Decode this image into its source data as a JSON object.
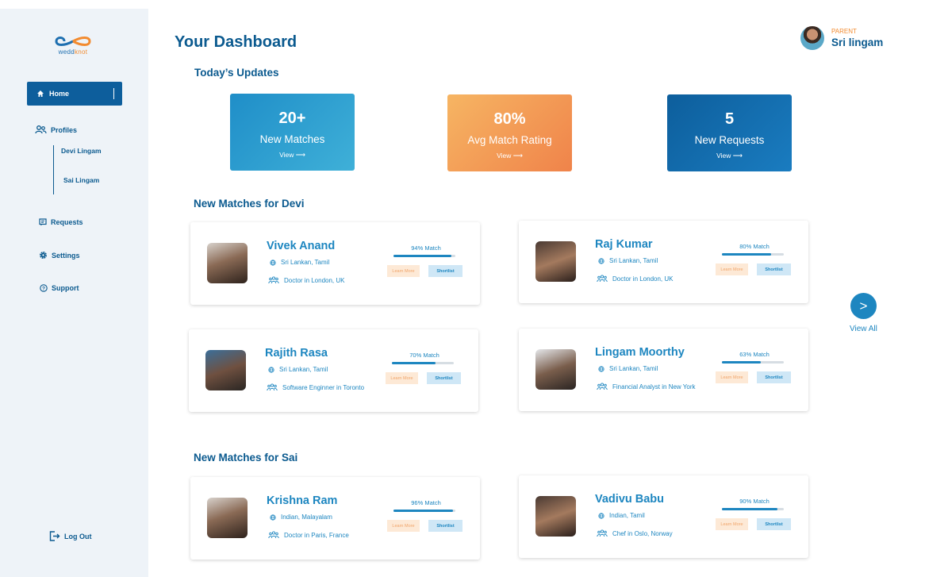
{
  "brand": {
    "part1": "wedd",
    "part2": "knot"
  },
  "sidebar": {
    "home": "Home",
    "profiles": "Profiles",
    "profile_children": [
      "Devi Lingam",
      "Sai Lingam"
    ],
    "requests": "Requests",
    "settings": "Settings",
    "support": "Support",
    "logout": "Log Out"
  },
  "header": {
    "title": "Your Dashboard",
    "user_role": "PARENT",
    "user_name": "Sri lingam"
  },
  "updates": {
    "title": "Today’s Updates",
    "cards": [
      {
        "value": "20+",
        "label": "New Matches",
        "link": "View"
      },
      {
        "value": "80%",
        "label": "Avg Match Rating",
        "link": "View"
      },
      {
        "value": "5",
        "label": "New Requests",
        "link": "View"
      }
    ]
  },
  "devi": {
    "title": "New Matches for Devi",
    "matches": [
      {
        "name": "Vivek Anand",
        "origin": "Sri Lankan, Tamil",
        "job": "Doctor in London, UK",
        "match_label": "94% Match",
        "match": 0.94
      },
      {
        "name": "Raj Kumar",
        "origin": "Sri Lankan, Tamil",
        "job": "Doctor in London, UK",
        "match_label": "80% Match",
        "match": 0.8
      },
      {
        "name": "Rajith Rasa",
        "origin": "Sri Lankan, Tamil",
        "job": "Software Enginner in Toronto",
        "match_label": "70% Match",
        "match": 0.7
      },
      {
        "name": "Lingam Moorthy",
        "origin": "Sri Lankan, Tamil",
        "job": "Financial Analyst in New York",
        "match_label": "63% Match",
        "match": 0.63
      }
    ]
  },
  "sai": {
    "title": "New Matches for Sai",
    "matches": [
      {
        "name": "Krishna Ram",
        "origin": "Indian, Malayalam",
        "job": "Doctor in Paris, France",
        "match_label": "96% Match",
        "match": 0.96
      },
      {
        "name": "Vadivu Babu",
        "origin": "Indian, Tamil",
        "job": "Chef in Oslo, Norway",
        "match_label": "90% Match",
        "match": 0.9
      }
    ]
  },
  "buttons": {
    "learn_more": "Learn More",
    "shortlist": "Shortlist"
  },
  "view_all": {
    "icon": ">",
    "label": "View All"
  },
  "colors": {
    "primary": "#0b5a8f",
    "accent": "#1d86c0",
    "orange": "#f28b30",
    "sidebar_bg": "#eef3f8"
  }
}
